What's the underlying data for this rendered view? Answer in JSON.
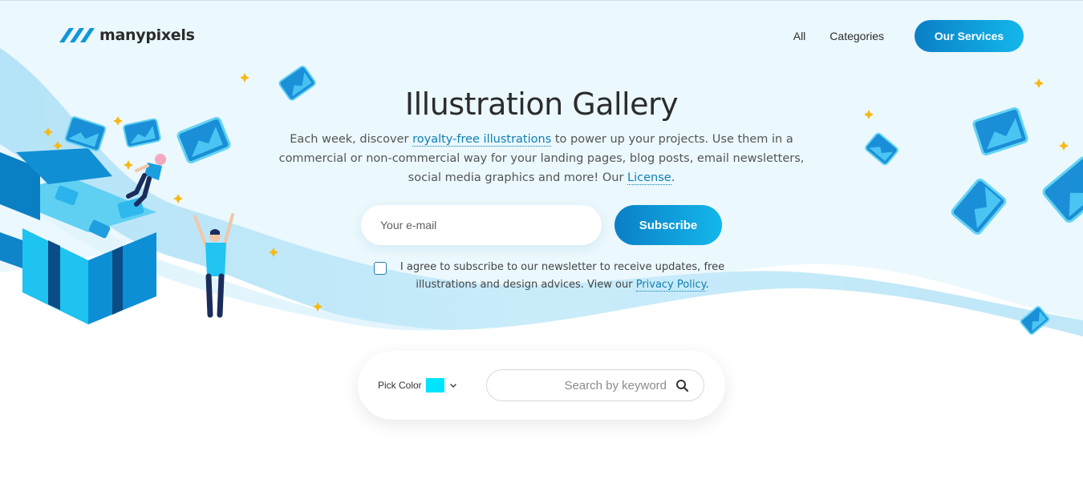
{
  "header": {
    "logo_text": "manypixels",
    "nav": [
      {
        "label": "All"
      },
      {
        "label": "Categories"
      }
    ],
    "cta_label": "Our Services"
  },
  "hero": {
    "title": "Illustration Gallery",
    "intro_before_link": "Each week, discover ",
    "intro_link": "royalty-free illustrations",
    "intro_after_link": " to power up your projects. Use them in a commercial or non-commercial way for your landing pages, blog posts, email newsletters, social media graphics and more! Our ",
    "license_link": "License",
    "intro_end": "."
  },
  "subscribe": {
    "email_placeholder": "Your e-mail",
    "button_label": "Subscribe",
    "consent_text": "I agree to subscribe to our newsletter to receive updates, free illustrations and design advices. View our ",
    "privacy_link": "Privacy Policy",
    "consent_end": "."
  },
  "filter": {
    "pick_label": "Pick Color",
    "selected_color": "#00e5ff",
    "search_placeholder": "Search by keyword"
  },
  "icons": {
    "logo": "stripes-logo-icon",
    "dropdown": "chevron-down-icon",
    "search": "search-icon"
  },
  "colors": {
    "accent_start": "#0a7fc6",
    "accent_end": "#14b7ea",
    "hero_background": "#ebf8fd"
  }
}
